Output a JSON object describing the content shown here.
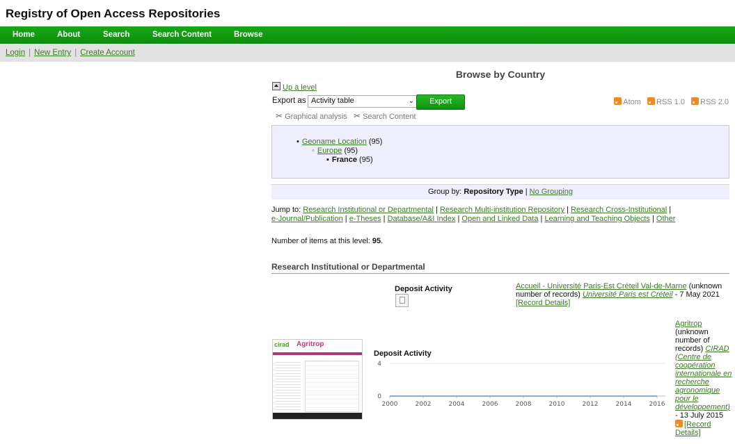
{
  "site_title": "Registry of Open Access Repositories",
  "nav": [
    "Home",
    "About",
    "Search",
    "Search Content",
    "Browse"
  ],
  "sublinks": [
    "Login",
    "New Entry",
    "Create Account"
  ],
  "page_heading": "Browse by Country",
  "up_level": "Up a level",
  "export": {
    "label": "Export as",
    "selected": "Activity table",
    "button": "Export"
  },
  "feeds": [
    "Atom",
    "RSS 1.0",
    "RSS 2.0"
  ],
  "tools": [
    "Graphical analysis",
    "Search Content"
  ],
  "tree": {
    "level1_label": "Geoname Location",
    "level1_count": "(95)",
    "level2_label": "Europe",
    "level2_count": "(95)",
    "level3_label": "France",
    "level3_count": "(95)"
  },
  "groupby": {
    "prefix": "Group by:",
    "current": "Repository Type",
    "sep": "|",
    "alt": "No Grouping"
  },
  "jump": {
    "prefix": "Jump to:",
    "links": [
      "Research Institutional or Departmental",
      "Research Multi-institution Repository",
      "Research Cross-Institutional",
      "e-Journal/Publication",
      "e-Theses",
      "Database/A&I Index",
      "Open and Linked Data",
      "Learning and Teaching Objects",
      "Other"
    ]
  },
  "count": {
    "prefix": "Number of items at this level:",
    "value": "95",
    "suffix": "."
  },
  "section_title": "Research Institutional or Departmental",
  "entry1": {
    "deposit_activity": "Deposit Activity",
    "name": "Accueil - Université Paris-Est Créteil Val-de-Marne",
    "records": " (unknown number of records) ",
    "org": "Université Paris est Créteil",
    "date": " - 7 May 2021",
    "details": "[Record Details]"
  },
  "entry2": {
    "thumb_logo": "cirad",
    "thumb_logo2": "Agritrop",
    "name": "Agritrop",
    "records": " (unknown number of records) ",
    "org": "CIRAD (Centre de coopération internationale en recherche agronomique pour le développement)",
    "date": " - 13 July 2015",
    "details": "[Record Details]"
  },
  "chart_data": {
    "type": "line",
    "title": "Deposit Activity",
    "x": [
      2000,
      2002,
      2004,
      2006,
      2008,
      2010,
      2012,
      2014,
      2016
    ],
    "series": [
      {
        "values": [
          0,
          0,
          0,
          0,
          0,
          0,
          0,
          0,
          0
        ]
      }
    ],
    "xlim": [
      2000,
      2016.5
    ],
    "ylim": [
      0,
      4
    ],
    "yticks": [
      0,
      4
    ],
    "xticks": [
      "2000",
      "2002",
      "2004",
      "2006",
      "2008",
      "2010",
      "2012",
      "2014",
      "2016"
    ],
    "grid": true,
    "colors": {
      "line": "#6a8fd6",
      "grid": "#e6e6e6",
      "axis": "#bbb"
    }
  }
}
